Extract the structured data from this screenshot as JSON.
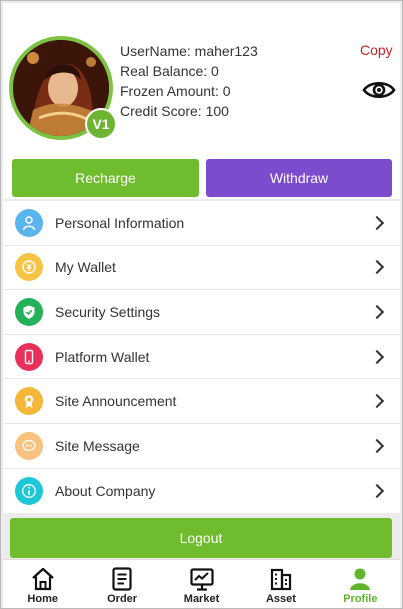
{
  "profile": {
    "username_line": "UserName: maher123",
    "real_balance_line": "Real Balance: 0",
    "frozen_amount_line": "Frozen Amount: 0",
    "credit_score_line": "Credit Score: 100",
    "vip_badge": "V1",
    "copy_label": "Copy",
    "eye_icon": "eye-icon"
  },
  "actions": {
    "recharge_label": "Recharge",
    "withdraw_label": "Withdraw"
  },
  "menu": {
    "items": [
      {
        "label": "Personal Information",
        "icon": "user-icon",
        "color": "#5ab5ef"
      },
      {
        "label": "My Wallet",
        "icon": "wallet-coin-icon",
        "color": "#f6c344"
      },
      {
        "label": "Security Settings",
        "icon": "shield-check-icon",
        "color": "#25b05a"
      },
      {
        "label": "Platform Wallet",
        "icon": "phone-icon",
        "color": "#e8305b"
      },
      {
        "label": "Site Announcement",
        "icon": "award-icon",
        "color": "#f4b737"
      },
      {
        "label": "Site Message",
        "icon": "chat-bubble-icon",
        "color": "#f9c27e"
      },
      {
        "label": "About Company",
        "icon": "info-icon",
        "color": "#1fc7d6"
      }
    ]
  },
  "logout_label": "Logout",
  "nav": {
    "items": [
      {
        "label": "Home",
        "icon": "home-icon"
      },
      {
        "label": "Order",
        "icon": "order-list-icon"
      },
      {
        "label": "Market",
        "icon": "market-chart-icon"
      },
      {
        "label": "Asset",
        "icon": "asset-building-icon"
      },
      {
        "label": "Profile",
        "icon": "profile-icon"
      }
    ],
    "active": "Profile"
  },
  "colors": {
    "accent_green": "#6fbd2e",
    "withdraw_purple": "#7c4ccf",
    "copy_red": "#c52222"
  }
}
